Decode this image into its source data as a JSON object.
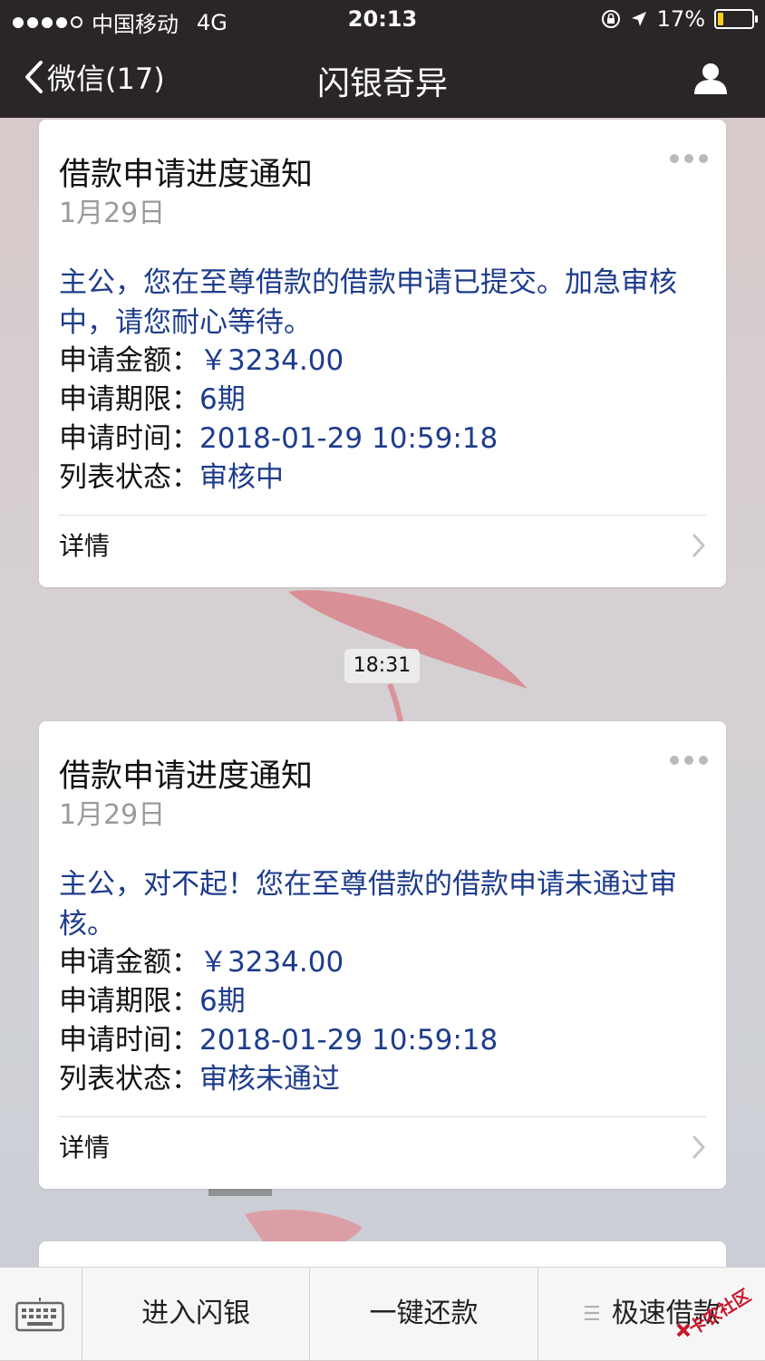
{
  "status_bar": {
    "carrier": "中国移动",
    "network": "4G",
    "time": "20:13",
    "battery_percent": "17%",
    "battery_level": 0.17
  },
  "nav": {
    "back_label": "微信(17)",
    "title": "闪银奇异"
  },
  "cards": [
    {
      "title": "借款申请进度通知",
      "date": "1月29日",
      "intro": "主公，您在至尊借款的借款申请已提交。加急审核中，请您耐心等待。",
      "rows": [
        {
          "label": "申请金额：",
          "value": "￥3234.00"
        },
        {
          "label": "申请期限：",
          "value": "6期"
        },
        {
          "label": "申请时间：",
          "value": "2018-01-29 10:59:18"
        },
        {
          "label": "列表状态：",
          "value": "审核中"
        }
      ],
      "detail_label": "详情"
    },
    {
      "title": "借款申请进度通知",
      "date": "1月29日",
      "intro": "主公，对不起！您在至尊借款的借款申请未通过审核。",
      "rows": [
        {
          "label": "申请金额：",
          "value": "￥3234.00"
        },
        {
          "label": "申请期限：",
          "value": "6期"
        },
        {
          "label": "申请时间：",
          "value": "2018-01-29 10:59:18"
        },
        {
          "label": "列表状态：",
          "value": "审核未通过"
        }
      ],
      "detail_label": "详情"
    }
  ],
  "timestamp_pill": "18:31",
  "bottom_menu": {
    "items": [
      "进入闪银",
      "一键还款",
      "极速借款"
    ]
  },
  "watermark_text": "卡农社区",
  "colors": {
    "nav_bg": "#2a2527",
    "link_blue": "#1e3c8c",
    "battery_yellow": "#f4d01c"
  }
}
